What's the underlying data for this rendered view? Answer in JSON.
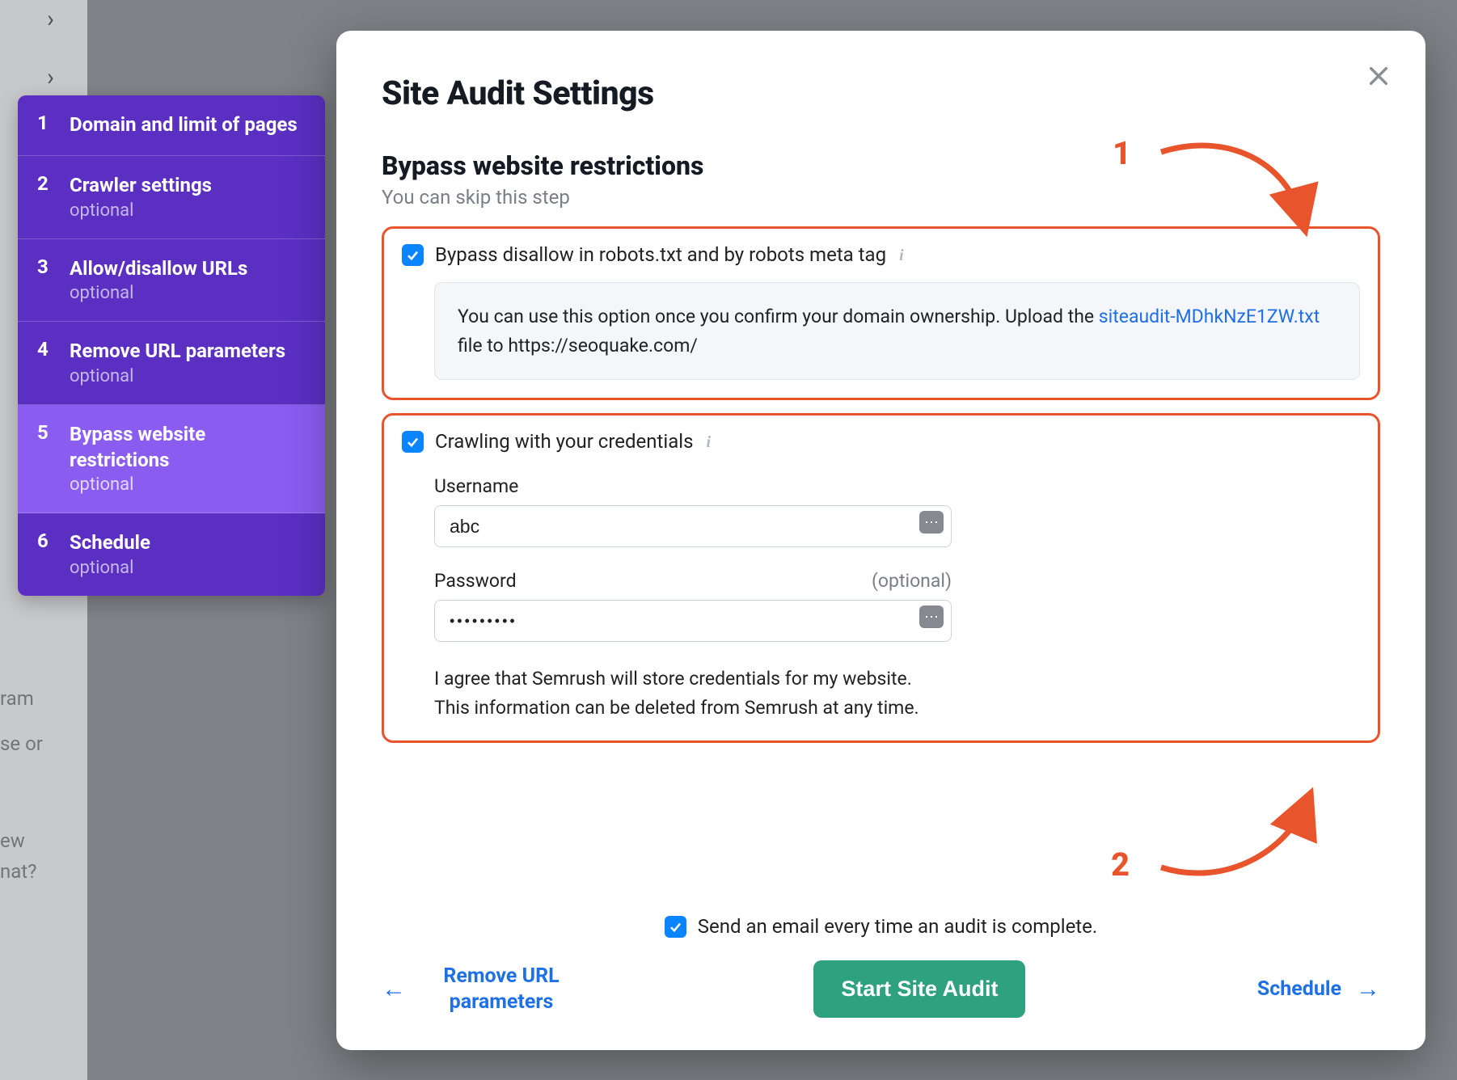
{
  "sidebar": {
    "steps": [
      {
        "num": "1",
        "title": "Domain and limit of pages",
        "optional": ""
      },
      {
        "num": "2",
        "title": "Crawler settings",
        "optional": "optional"
      },
      {
        "num": "3",
        "title": "Allow/disallow URLs",
        "optional": "optional"
      },
      {
        "num": "4",
        "title": "Remove URL parameters",
        "optional": "optional"
      },
      {
        "num": "5",
        "title": "Bypass website restrictions",
        "optional": "optional"
      },
      {
        "num": "6",
        "title": "Schedule",
        "optional": "optional"
      }
    ]
  },
  "modal": {
    "title": "Site Audit Settings",
    "section_title": "Bypass website restrictions",
    "section_hint": "You can skip this step",
    "bypass": {
      "label": "Bypass disallow in robots.txt and by robots meta tag",
      "hint_pre": "You can use this option once you confirm your domain ownership. Upload the ",
      "hint_link": "siteaudit-MDhkNzE1ZW.txt",
      "hint_post": " file to https://seoquake.com/"
    },
    "creds": {
      "label": "Crawling with your credentials",
      "username_label": "Username",
      "username_value": "abc",
      "password_label": "Password",
      "password_optional": "(optional)",
      "password_value": "•••••••••",
      "agree": "I agree that Semrush will store credentials for my website. This information can be deleted from Semrush at any time."
    },
    "footer": {
      "email_label": "Send an email every time an audit is complete.",
      "prev": "Remove URL parameters",
      "start": "Start Site Audit",
      "next": "Schedule"
    }
  },
  "annotations": {
    "one": "1",
    "two": "2"
  },
  "background_text": {
    "ram": "ram",
    "seor": "se or",
    "ew": "ew",
    "nat": "nat?"
  }
}
